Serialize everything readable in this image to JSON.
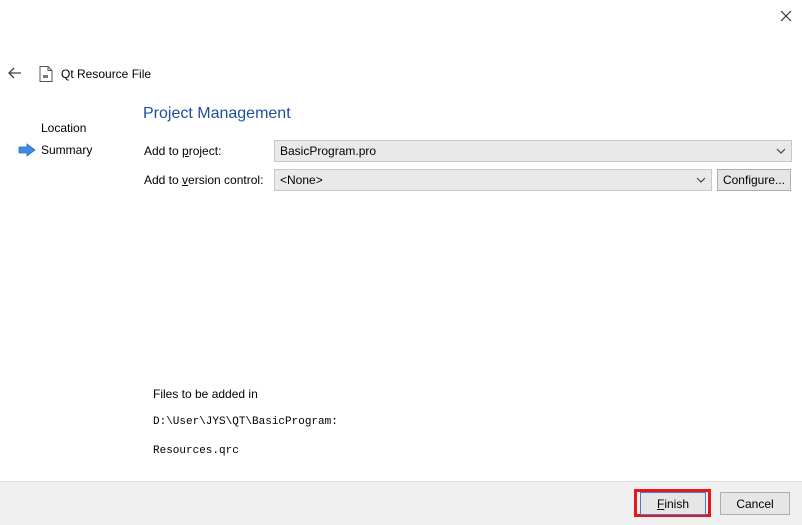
{
  "window": {
    "title": "Qt Resource File"
  },
  "nav": {
    "items": [
      {
        "label": "Location",
        "current": false
      },
      {
        "label": "Summary",
        "current": true
      }
    ]
  },
  "page": {
    "heading": "Project Management",
    "add_to_project": {
      "label_pre": "Add to ",
      "label_ul": "p",
      "label_post": "roject:",
      "value": "BasicProgram.pro"
    },
    "add_to_vcs": {
      "label_pre": "Add to ",
      "label_ul": "v",
      "label_post": "ersion control:",
      "value": "<None>",
      "configure_label": "Configure..."
    },
    "files": {
      "header": "Files to be added in",
      "path": "D:\\User\\JYS\\QT\\BasicProgram:",
      "file": "Resources.qrc"
    }
  },
  "footer": {
    "finish_ul": "F",
    "finish_rest": "inish",
    "cancel_label": "Cancel",
    "highlight_color": "#e8141e"
  },
  "colors": {
    "heading": "#1f4e9c",
    "nav_arrow": "#3c8ee0",
    "footer_bg": "#f0f0f0"
  }
}
